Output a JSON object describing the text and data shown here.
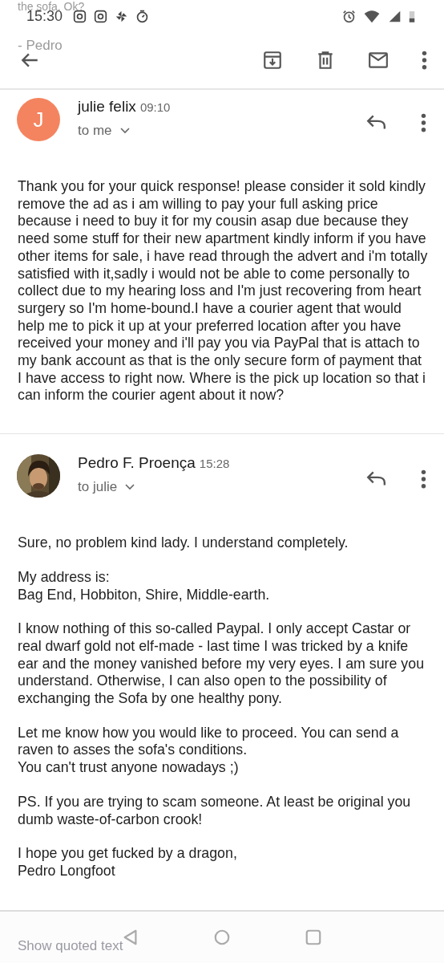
{
  "ghost_texts": {
    "top_line": "the sofa. Ok?",
    "signature": "- Pedro",
    "bottom_link": "Show quoted text"
  },
  "status_bar": {
    "time": "15:30"
  },
  "messages": [
    {
      "sender": "julie felix",
      "time": "09:10",
      "recipient": "to me",
      "avatar": {
        "kind": "letter",
        "letter": "J",
        "color": "#f4845f"
      },
      "paragraphs": [
        "Thank you for your quick response! please consider it sold kindly remove the ad as i am willing to pay your full asking price because i need to buy it for my cousin asap due because they need some stuff for their new apartment kindly inform if you have other items for sale, i have read through the advert and i'm totally satisfied with it,sadly i would not be able to come personally to collect due to my hearing loss and I'm just recovering from heart surgery so I'm home-bound.I have a courier agent that would help me to pick it up at your preferred location after you have received your money and i'll pay you via PayPal that is attach to my bank account as that is the only secure form of payment that I have access to right now. Where is the pick up location so that i can inform the courier agent about it now?"
      ]
    },
    {
      "sender": "Pedro F. Proença",
      "time": "15:28",
      "recipient": "to julie",
      "paragraphs": [
        "Sure, no problem kind lady. I understand completely.",
        "My address is:\nBag End, Hobbiton, Shire, Middle-earth.",
        "I know nothing of this so-called Paypal. I only accept Castar or real dwarf gold not elf-made - last time I was tricked by a knife ear and the money vanished before my very eyes. I am sure you understand. Otherwise, I can also open to the possibility of exchanging the Sofa by one healthy pony.",
        "Let me know how you would like to proceed. You can send a raven to asses the sofa's conditions.\nYou can't trust anyone nowadays ;)",
        "PS. If you are trying to scam someone. At least be original you dumb waste-of-carbon crook!",
        "I hope you get fucked by a dragon,\nPedro Longfoot"
      ]
    }
  ]
}
